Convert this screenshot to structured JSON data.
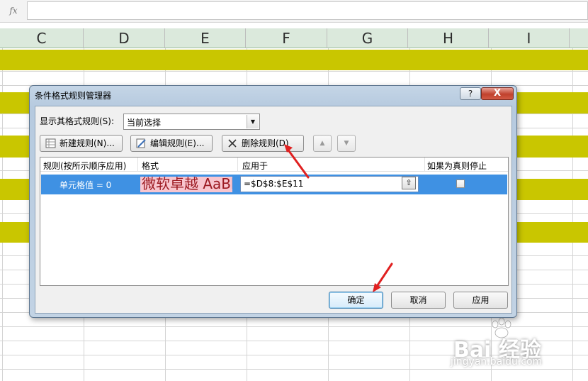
{
  "formula_bar": {
    "fx_label": "fx",
    "value": ""
  },
  "columns": [
    "C",
    "D",
    "E",
    "F",
    "G",
    "H",
    "I"
  ],
  "dialog": {
    "title": "条件格式规则管理器",
    "help_label": "?",
    "close_label": "X",
    "show_rules_label": "显示其格式规则(S):",
    "show_rules_value": "当前选择",
    "toolbar": {
      "new_rule": "新建规则(N)...",
      "edit_rule": "编辑规则(E)...",
      "delete_rule": "删除规则(D)",
      "move_up": "▲",
      "move_down": "▼"
    },
    "list_headers": {
      "rule": "规则(按所示顺序应用)",
      "format": "格式",
      "applies_to": "应用于",
      "stop_if_true": "如果为真则停止"
    },
    "rules": [
      {
        "rule": "单元格值 = 0",
        "format_preview": "微软卓越 AaBb",
        "applies_to": "=$D$8:$E$11",
        "stop_if_true": false
      }
    ],
    "footer": {
      "ok": "确定",
      "cancel": "取消",
      "apply": "应用"
    }
  },
  "watermark": {
    "brand": "Bai  经验",
    "url": "jingyan.baidu.com"
  },
  "colors": {
    "band": "#c9c600",
    "header_bg": "#dbe9dc",
    "selected_row": "#3f91e3",
    "annotation_arrow": "#e02020"
  }
}
